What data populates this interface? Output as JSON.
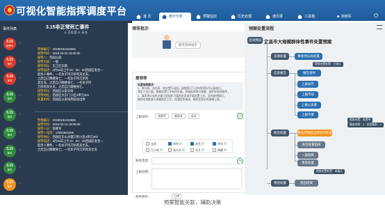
{
  "app": {
    "title": "可视化智能指挥调度平台"
  },
  "nav": {
    "tabs": [
      {
        "label": "首 页",
        "active": false
      },
      {
        "label": "统计分析",
        "active": true
      },
      {
        "label": "预警监控",
        "active": false
      },
      {
        "label": "历史处理",
        "active": false
      },
      {
        "label": "通讯录",
        "active": false
      },
      {
        "label": "工具箱",
        "active": false
      }
    ],
    "user": "张继军"
  },
  "sidebar": {
    "list_title": "事件列表",
    "event_title": "3.15非正常死亡事件",
    "event_sub": "◎ 已处理  ⊘ 未办",
    "rows": [
      {
        "num": "3.15",
        "sub": "处理中",
        "color": "#d83b2b"
      },
      {
        "num": "3.15",
        "sub": "事件",
        "color": "#d83b2b"
      },
      {
        "num": "3.15",
        "sub": "事件",
        "color": "#d83b2b"
      },
      {
        "num": "3.15",
        "sub": "事件",
        "color": "#2f8a3c"
      },
      {
        "num": "3.15",
        "sub": "事件",
        "color": "#2f8a3c"
      },
      {
        "num": "3.15",
        "sub": "事件",
        "color": "#2f8a3c"
      },
      {
        "num": "3.15",
        "sub": "事件",
        "color": "#2f8a3c"
      },
      {
        "num": "3.15",
        "sub": "事件",
        "color": "#2f8a3c"
      },
      {
        "num": "3.15",
        "sub": "事件",
        "color": "#f0931f"
      }
    ],
    "detail1": [
      "警情编号：20180184434555",
      "报警时间：2018-03-15 19:00:00",
      "报警人：西园公园",
      "报警内容：一般",
      "报警地址：东江区东路",
      "报警描述：3月15日上午10：05：00西园区发生一",
      "起杀人事件，一名女子持刀杀死其丈夫，",
      "之后自己跳楼身亡，一名女子持刀杀死",
      "其丈夫，之后自己跳楼身亡，一名女子持",
      "刀杀死其丈夫，之后自己跳楼身亡。",
      "接警单位：西园区公安分局",
      "接警地址：西园区大东门小区2单元302",
      "处置机构：西园区公安局西园派出所"
    ],
    "detail2": [
      "警情编号：20180184434555",
      "报警时间：2018-03-15 19:00:00",
      "报警人员：张继军",
      "报警人电话：13853562456",
      "报警地址：西园区东山大厦口附小区3单元302",
      "报警描述：3月15日上午10：00：00西园区发生一",
      "起杀人事件，一名女子持刀杀死其丈夫，",
      "之后自己跳楼身亡，一名女子持刀杀死其丈夫"
    ],
    "badges": {
      "sidebar_bottom": "1"
    }
  },
  "guide": {
    "section1": "领导批示",
    "bubble": "暂无领导批示",
    "section2": "报领导",
    "instr_title": "处置指挥要求：",
    "instr_lines": [
      "1、各分局、派出所、各处置行动组，请按照已下达的各项指令认真执行，",
      "落实人员力量，确保处置工作有序开展，积极组织群众疏散，维护好现场秩序，",
      "2、事发地公安机关要立即组织力量赶赴现场开展处置工作，及时查明情况，",
      "做好现场勘查与调查取证工作，加强信息报送，确保信息及时准确上报。"
    ],
    "report_label": "上报领导：",
    "report_chips": [
      "张继军",
      "副局长",
      "局长"
    ],
    "depts": [
      {
        "name": "全选",
        "checked": false
      },
      {
        "name": "刘伟",
        "checked": true
      },
      {
        "name": "赵东",
        "checked": true
      },
      {
        "name": "李军",
        "checked": true
      },
      {
        "name": "王小成",
        "checked": false
      },
      {
        "name": "张大光",
        "checked": false
      },
      {
        "name": "孙文",
        "checked": false
      },
      {
        "name": "周娜",
        "checked": false
      }
    ],
    "phone_label": "联系电话：",
    "record_label": "上报说明：",
    "attach_label": "附件附件：",
    "attach_btn": "上传"
  },
  "flow": {
    "title": "预案处置流程",
    "root": "启动预案",
    "plan": "宜昌市大规模群体性事件处置预案",
    "nodes": [
      "先期处置",
      "事发地分局处置",
      "信息报告",
      "报告领导",
      "上报省厅",
      "上报市局",
      "上报公安部",
      "上报市委",
      "联合处置",
      "事态控制后立即召开会议",
      "联合处置指挥",
      "一般指挥",
      "善后处置",
      "善后结束"
    ],
    "notes": [
      "提前处置处置：已指示",
      "提前处置：处置中",
      "事态持续：4 · 发现事态：3",
      "提前处置处置：未指示"
    ]
  },
  "caption": "预案智能关联，辅助决策"
}
